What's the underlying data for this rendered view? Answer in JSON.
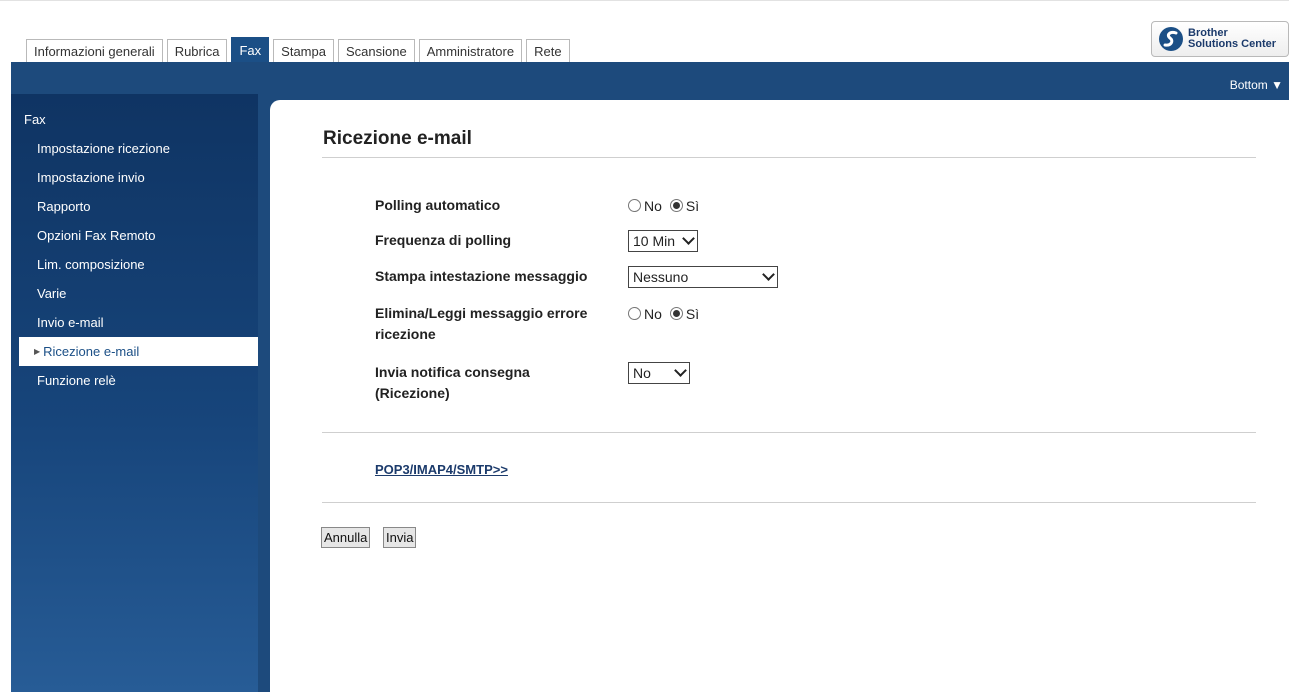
{
  "tabs": [
    {
      "label": "Informazioni generali",
      "active": false
    },
    {
      "label": "Rubrica",
      "active": false
    },
    {
      "label": "Fax",
      "active": true
    },
    {
      "label": "Stampa",
      "active": false
    },
    {
      "label": "Scansione",
      "active": false
    },
    {
      "label": "Amministratore",
      "active": false
    },
    {
      "label": "Rete",
      "active": false
    }
  ],
  "brand": {
    "line1": "Brother",
    "line2": "Solutions Center",
    "icon": "brother-s-logo-icon",
    "color": "#1b3a6b"
  },
  "header": {
    "bottom_link": "Bottom",
    "bottom_icon": "triangle-down-icon",
    "band_color": "#1d4a7c"
  },
  "sidebar": {
    "title": "Fax",
    "items": [
      {
        "label": "Impostazione ricezione",
        "active": false
      },
      {
        "label": "Impostazione invio",
        "active": false
      },
      {
        "label": "Rapporto",
        "active": false
      },
      {
        "label": "Opzioni Fax Remoto",
        "active": false
      },
      {
        "label": "Lim. composizione",
        "active": false
      },
      {
        "label": "Varie",
        "active": false
      },
      {
        "label": "Invio e-mail",
        "active": false
      },
      {
        "label": "Ricezione e-mail",
        "active": true
      },
      {
        "label": "Funzione relè",
        "active": false
      }
    ]
  },
  "main": {
    "title": "Ricezione e-mail",
    "fields": {
      "polling_auto": {
        "label": "Polling automatico",
        "options": [
          "No",
          "Sì"
        ],
        "selected": "Sì"
      },
      "polling_freq": {
        "label": "Frequenza di polling",
        "value": "10 Min"
      },
      "print_header": {
        "label": "Stampa intestazione messaggio",
        "value": "Nessuno"
      },
      "delete_error": {
        "label_line1": "Elimina/Leggi messaggio errore",
        "label_line2": "ricezione",
        "options": [
          "No",
          "Sì"
        ],
        "selected": "Sì"
      },
      "delivery_notify": {
        "label_line1": "Invia notifica consegna",
        "label_line2": "(Ricezione)",
        "value": "No"
      }
    },
    "link": "POP3/IMAP4/SMTP>>",
    "buttons": {
      "cancel": "Annulla",
      "submit": "Invia"
    }
  }
}
